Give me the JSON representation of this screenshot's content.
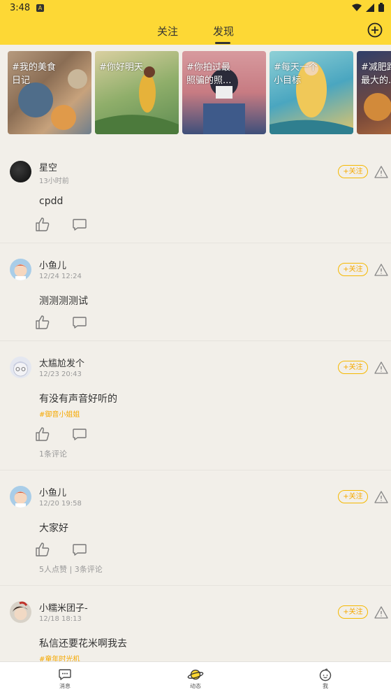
{
  "status": {
    "time": "3:48"
  },
  "header": {
    "tabs": [
      {
        "label": "关注"
      },
      {
        "label": "发现"
      }
    ],
    "active_tab": "发现"
  },
  "banners": [
    {
      "label": "#我的美食\n日记"
    },
    {
      "label": "#你好明天"
    },
    {
      "label": "#你拍过最\n照骗的照..."
    },
    {
      "label": "#每天一个\n小目标"
    },
    {
      "label": "#减肥路\n最大的..."
    }
  ],
  "posts": [
    {
      "username": "星空",
      "time": "13小时前",
      "text": "cpdd",
      "follow_label": "+关注",
      "topic": "",
      "meta": ""
    },
    {
      "username": "小鱼儿",
      "time": "12/24 12:24",
      "text": "测测测测试",
      "follow_label": "+关注",
      "topic": "",
      "meta": ""
    },
    {
      "username": "太尴尬发个",
      "time": "12/23 20:43",
      "text": "有没有声音好听的",
      "follow_label": "+关注",
      "topic": "#御音小姐姐",
      "meta": "1条评论"
    },
    {
      "username": "小鱼儿",
      "time": "12/20 19:58",
      "text": "大家好",
      "follow_label": "+关注",
      "topic": "",
      "meta": "5人点赞 | 3条评论"
    },
    {
      "username": "小糯米团子-",
      "time": "12/18 18:13",
      "text": "私信还要花米啊我去",
      "follow_label": "+关注",
      "topic": "#童年时光机",
      "meta": ""
    }
  ],
  "bottom_nav": {
    "items": [
      {
        "label": "消息"
      },
      {
        "label": "动态"
      },
      {
        "label": "我"
      }
    ],
    "active": "动态"
  },
  "colors": {
    "brand_yellow": "#fdd835",
    "accent_orange": "#f5a800",
    "background": "#f2efe9"
  },
  "icons": [
    "add-circle-icon",
    "like-icon",
    "comment-icon",
    "report-warning-icon",
    "message-icon",
    "planet-icon",
    "profile-icon",
    "wifi-icon",
    "signal-icon",
    "battery-icon"
  ]
}
